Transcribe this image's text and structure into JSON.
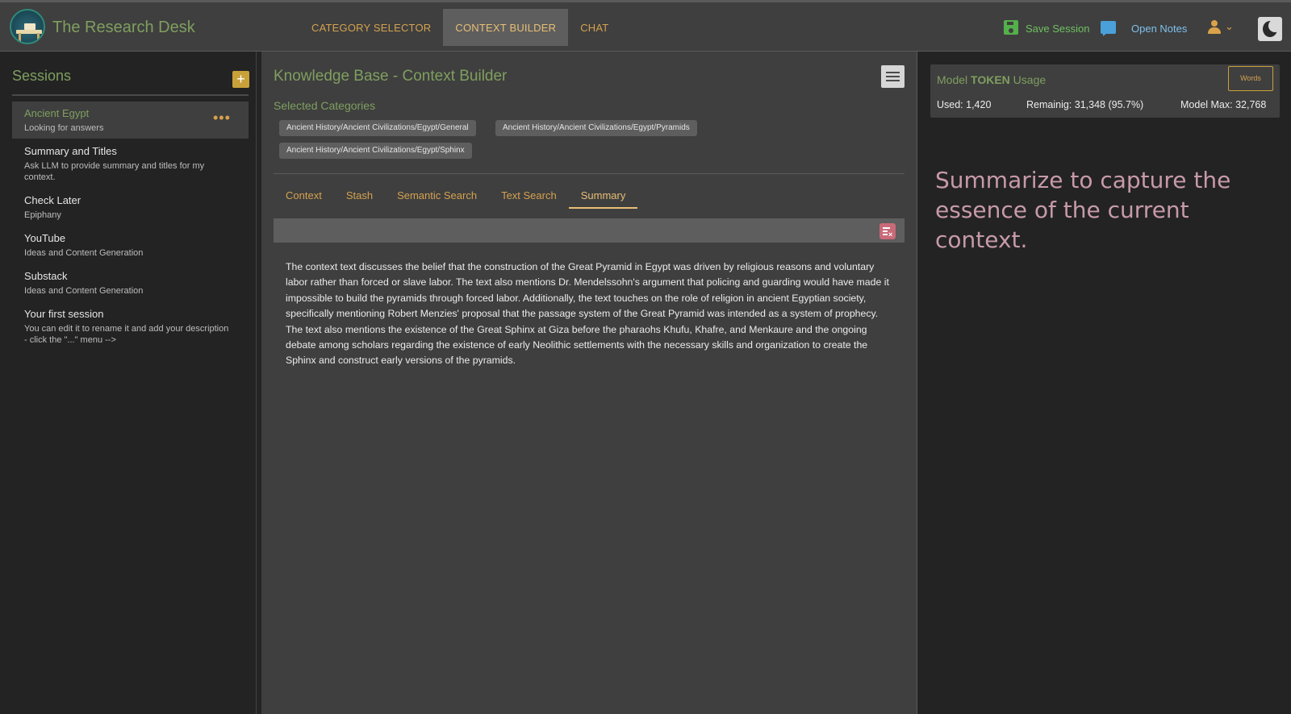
{
  "app": {
    "title": "The Research Desk"
  },
  "nav": {
    "items": [
      {
        "label": "CATEGORY SELECTOR",
        "active": false
      },
      {
        "label": "CONTEXT BUILDER",
        "active": true
      },
      {
        "label": "CHAT",
        "active": false
      }
    ]
  },
  "header": {
    "save_label": "Save Session",
    "notes_label": "Open Notes",
    "icons": [
      "save-icon",
      "notes-icon",
      "user-icon",
      "chevron-down-icon",
      "theme-toggle-icon"
    ]
  },
  "sidebar": {
    "title": "Sessions",
    "add_label": "+",
    "more_label": "•••",
    "sessions": [
      {
        "title": "Ancient Egypt",
        "description": "Looking for answers",
        "active": true
      },
      {
        "title": "Summary and Titles",
        "description": "Ask LLM to provide summary and titles for my context.",
        "active": false
      },
      {
        "title": "Check Later",
        "description": "Epiphany",
        "active": false
      },
      {
        "title": "YouTube",
        "description": "Ideas and Content Generation",
        "active": false
      },
      {
        "title": "Substack",
        "description": "Ideas and Content Generation",
        "active": false
      },
      {
        "title": "Your first session",
        "description": "You can edit it to rename it and add your description - click the \"...\" menu -->",
        "active": false
      }
    ]
  },
  "main": {
    "title": "Knowledge Base - Context Builder",
    "selected_label": "Selected Categories",
    "categories": [
      "Ancient History/Ancient Civilizations/Egypt/General",
      "Ancient History/Ancient Civilizations/Egypt/Pyramids",
      "Ancient History/Ancient Civilizations/Egypt/Sphinx"
    ],
    "tabs": [
      {
        "label": "Context",
        "active": false
      },
      {
        "label": "Stash",
        "active": false
      },
      {
        "label": "Semantic Search",
        "active": false
      },
      {
        "label": "Text Search",
        "active": false
      },
      {
        "label": "Summary",
        "active": true
      }
    ],
    "summary": "The context text discusses the belief that the construction of the Great Pyramid in Egypt was driven by religious reasons and voluntary labor rather than forced or slave labor. The text also mentions Dr. Mendelssohn's argument that policing and guarding would have made it impossible to build the pyramids through forced labor. Additionally, the text touches on the role of religion in ancient Egyptian society, specifically mentioning Robert Menzies' proposal that the passage system of the Great Pyramid was intended as a system of prophecy. The text also mentions the existence of the Great Sphinx at Giza before the pharaohs Khufu, Khafre, and Menkaure and the ongoing debate among scholars regarding the existence of early Neolithic settlements with the necessary skills and organization to create the Sphinx and construct early versions of the pyramids."
  },
  "tokens": {
    "title_prefix": "Model ",
    "title_bold": "TOKEN",
    "title_suffix": " Usage",
    "words_label": "Words",
    "used": "Used: 1,420",
    "remaining": "Remainig: 31,348  (95.7%)",
    "max": "Model Max: 32,768"
  },
  "hint": "Summarize to capture the essence of the current context.",
  "colors": {
    "accent_gold": "#d4a24f",
    "brand_green": "#7f9f5f",
    "save_green": "#54b04a",
    "notes_blue": "#4aa0d8",
    "hint_pink": "#c79aa9"
  }
}
